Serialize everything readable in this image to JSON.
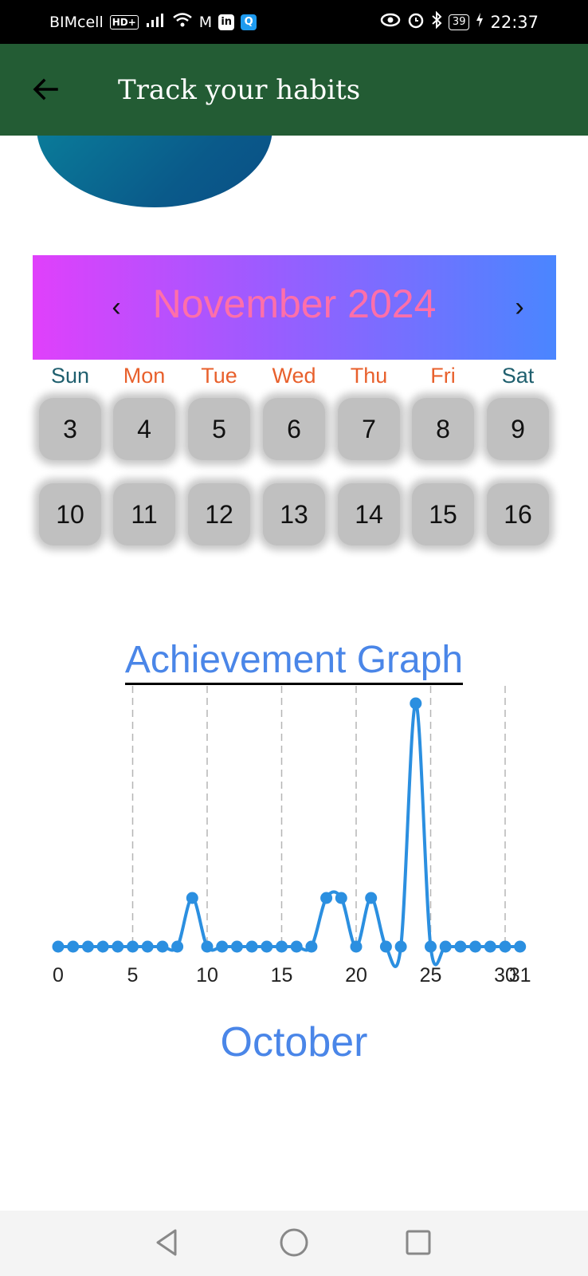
{
  "status_bar": {
    "carrier": "BIMcell",
    "hd_badge": "HD+",
    "mail_glyph": "M",
    "linkedin_glyph": "in",
    "q_glyph": "Q",
    "battery": "39",
    "time": "22:37"
  },
  "app_bar": {
    "title": "Track your habits",
    "back_icon": "arrow-left-icon"
  },
  "calendar": {
    "month_label": "November 2024",
    "prev_label": "‹",
    "next_label": "›",
    "weekdays": [
      {
        "label": "Sun",
        "color": "#1f5f6e"
      },
      {
        "label": "Mon",
        "color": "#e8602c"
      },
      {
        "label": "Tue",
        "color": "#e8602c"
      },
      {
        "label": "Wed",
        "color": "#e8602c"
      },
      {
        "label": "Thu",
        "color": "#e8602c"
      },
      {
        "label": "Fri",
        "color": "#e8602c"
      },
      {
        "label": "Sat",
        "color": "#1f5f6e"
      }
    ],
    "weeks": [
      [
        "3",
        "4",
        "5",
        "6",
        "7",
        "8",
        "9"
      ],
      [
        "10",
        "11",
        "12",
        "13",
        "14",
        "15",
        "16"
      ]
    ]
  },
  "chart_data": {
    "type": "line",
    "title": "Achievement Graph",
    "xlabel": "October",
    "x_ticks": [
      "0",
      "5",
      "10",
      "15",
      "20",
      "25",
      "30",
      "31"
    ],
    "x": [
      0,
      1,
      2,
      3,
      4,
      5,
      6,
      7,
      8,
      9,
      10,
      11,
      12,
      13,
      14,
      15,
      16,
      17,
      18,
      19,
      20,
      21,
      22,
      23,
      24,
      25,
      26,
      27,
      28,
      29,
      30,
      31
    ],
    "values": [
      0,
      0,
      0,
      0,
      0,
      0,
      0,
      0,
      0,
      1,
      0,
      0,
      0,
      0,
      0,
      0,
      0,
      0,
      1,
      1,
      0,
      1,
      0,
      0,
      5,
      0,
      0,
      0,
      0,
      0,
      0,
      0
    ],
    "ylim": [
      -0.3,
      5
    ],
    "grid": "vertical dashed",
    "line_color": "#2b8fe0"
  },
  "nav_bar": {
    "back": "back-triangle-icon",
    "home": "home-circle-icon",
    "recents": "recents-square-icon"
  }
}
